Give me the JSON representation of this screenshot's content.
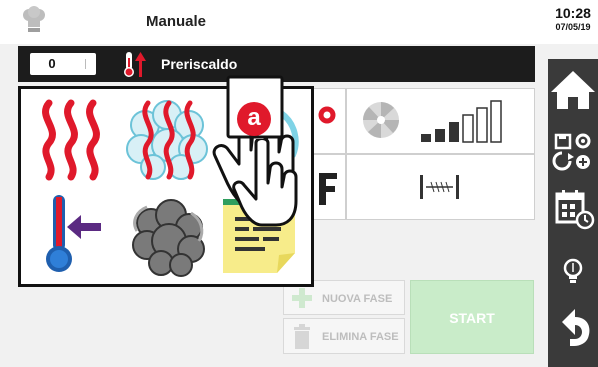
{
  "header": {
    "title": "Manuale"
  },
  "clock": {
    "time": "10:28",
    "date": "07/05/19"
  },
  "status": {
    "counter": "0",
    "label": "Preriscaldo"
  },
  "buttons": {
    "new_phase": "NUOVA FASE",
    "delete_phase": "ELIMINA FASE",
    "start": "START"
  },
  "callout": {
    "letter": "a"
  },
  "popup_items": [
    {
      "icon": "heat-waves-icon"
    },
    {
      "icon": "steam-heat-icon"
    },
    {
      "icon": "fan-icon"
    },
    {
      "icon": "cooling-thermometer-icon"
    },
    {
      "icon": "smoke-icon"
    },
    {
      "icon": "notes-icon"
    }
  ],
  "sidebar_icons": [
    "home-icon",
    "save-settings-icon",
    "calendar-icon",
    "bulb-icon",
    "back-icon"
  ],
  "colors": {
    "accent_red": "#e0192b",
    "start_green": "#c9ecc9",
    "dark": "#1c1c1c"
  }
}
